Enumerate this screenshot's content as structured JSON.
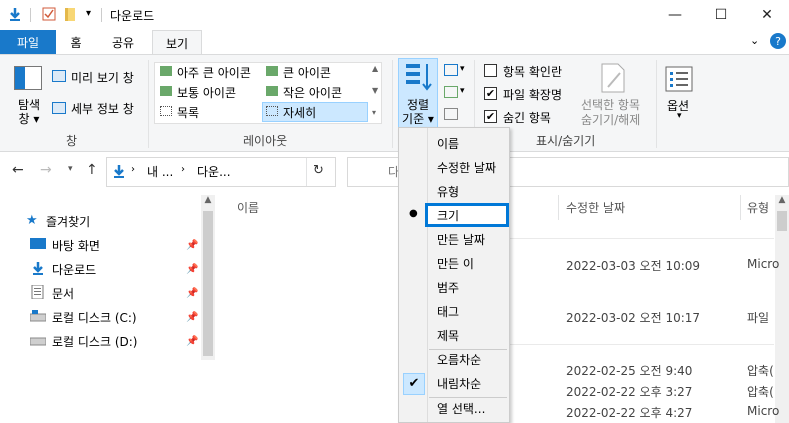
{
  "window": {
    "title": "다운로드",
    "minimize": "—",
    "maximize": "☐",
    "close": "✕"
  },
  "ribbon_tabs": {
    "file": "파일",
    "home": "홈",
    "share": "공유",
    "view": "보기"
  },
  "ribbon": {
    "nav_pane": "탐색\n창",
    "nav_pane_line1": "탐색",
    "nav_pane_line2": "창 ▾",
    "preview_pane": "미리 보기 창",
    "details_pane": "세부 정보 창",
    "group_panes": "창",
    "layout": {
      "extra_large": "아주 큰 아이콘",
      "large": "큰 아이콘",
      "medium": "보통 아이콘",
      "small": "작은 아이콘",
      "list": "목록",
      "details": "자세히"
    },
    "group_layout": "레이아웃",
    "sort_line1": "정렬",
    "sort_line2": "기준 ▾",
    "show_hide": {
      "item_checkboxes": "항목 확인란",
      "file_extensions": "파일 확장명",
      "hidden_items": "숨긴 항목",
      "item_checkboxes_checked": false,
      "file_extensions_checked": true,
      "hidden_items_checked": true,
      "hide_selected_line1": "선택한 항목",
      "hide_selected_line2": "숨기기/해제"
    },
    "group_show_hide": "표시/숨기기",
    "options": "옵션"
  },
  "address": {
    "path_part1": "내 ...",
    "path_part2": "다운...",
    "search_placeholder": "다"
  },
  "sidebar": {
    "quick_access": "즐겨찾기",
    "items": [
      {
        "label": "바탕 화면"
      },
      {
        "label": "다운로드"
      },
      {
        "label": "문서"
      },
      {
        "label": "로컬 디스크 (C:)"
      },
      {
        "label": "로컬 디스크 (D:)"
      }
    ]
  },
  "columns": {
    "name": "이름",
    "modified": "수정한 날짜",
    "type": "유형"
  },
  "rows": [
    {
      "date": "2022-03-03 오전 10:09",
      "type": "Micro"
    },
    {
      "date": "2022-03-02 오전 10:17",
      "type": "파일"
    },
    {
      "date": "2022-02-25 오전 9:40",
      "type": "압축("
    },
    {
      "date": "2022-02-22 오후 3:27",
      "type": "압축("
    },
    {
      "date": "2022-02-22 오후 4:27",
      "type": "Micro"
    }
  ],
  "sort_menu": {
    "items": [
      "이름",
      "수정한 날짜",
      "유형",
      "크기",
      "만든 날짜",
      "만든 이",
      "범주",
      "태그",
      "제목"
    ],
    "selected": "크기",
    "ascending": "오름차순",
    "descending": "내림차순",
    "choose_columns": "열 선택..."
  },
  "colors": {
    "accent": "#1979ca",
    "file_tab": "#1979ca",
    "highlight_border": "#0078d7",
    "folder_yellow": "#f8d775"
  }
}
